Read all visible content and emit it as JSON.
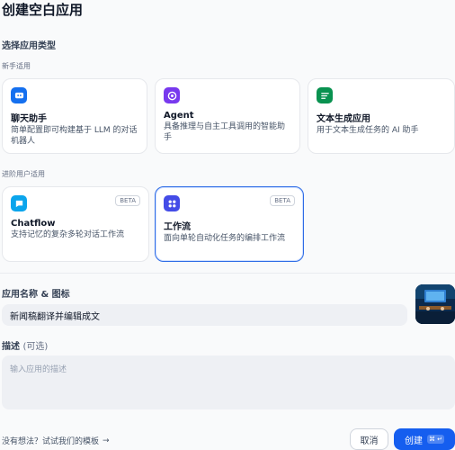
{
  "page": {
    "title": "创建空白应用",
    "type_section_label": "选择应用类型",
    "beginner_group_label": "新手适用",
    "advanced_group_label": "进阶用户适用"
  },
  "cards": {
    "chatbot": {
      "name": "聊天助手",
      "desc": "简单配置即可构建基于 LLM 的对话机器人",
      "icon": "chat-bot-icon",
      "color": "#1570ef"
    },
    "agent": {
      "name": "Agent",
      "desc": "具备推理与自主工具调用的智能助手",
      "icon": "agent-icon",
      "color": "#7839ee"
    },
    "textgen": {
      "name": "文本生成应用",
      "desc": "用于文本生成任务的 AI 助手",
      "icon": "text-generation-icon",
      "color": "#099250"
    },
    "chatflow": {
      "name": "Chatflow",
      "desc": "支持记忆的复杂多轮对话工作流",
      "badge": "BETA",
      "icon": "chatflow-icon",
      "color": "#0ba5ec"
    },
    "workflow": {
      "name": "工作流",
      "desc": "面向单轮自动化任务的编排工作流",
      "badge": "BETA",
      "icon": "workflow-icon",
      "color": "#444ce7"
    }
  },
  "form": {
    "name_label": "应用名称 & 图标",
    "name_value": "新闻稿翻译并编辑成文",
    "desc_label": "描述",
    "desc_optional": "(可选)",
    "desc_placeholder": "输入应用的描述"
  },
  "footer": {
    "template_link": "没有想法？试试我们的模板",
    "cancel_label": "取消",
    "create_label": "创建",
    "create_shortcut": "⌘ ↵"
  },
  "colors": {
    "accent": "#155eef",
    "selected_border": "#2e6ce6"
  }
}
